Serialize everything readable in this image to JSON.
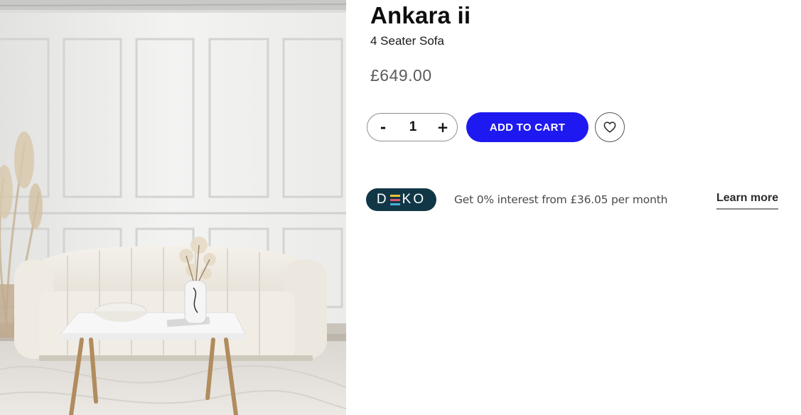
{
  "product": {
    "title": "Ankara ii",
    "subtitle": "4 Seater Sofa",
    "price": "£649.00"
  },
  "cart": {
    "quantity": "1",
    "decrement_label": "-",
    "increment_label": "+",
    "add_to_cart_label": "ADD TO CART",
    "wishlist_icon": "heart-icon"
  },
  "finance": {
    "provider_logo_left": "D",
    "provider_logo_right": "KO",
    "text": "Get 0% interest from £36.05 per month",
    "learn_more_label": "Learn more"
  },
  "colors": {
    "accent": "#1e19f0",
    "deko_badge": "#113747",
    "price_text": "#5b5b5b"
  }
}
